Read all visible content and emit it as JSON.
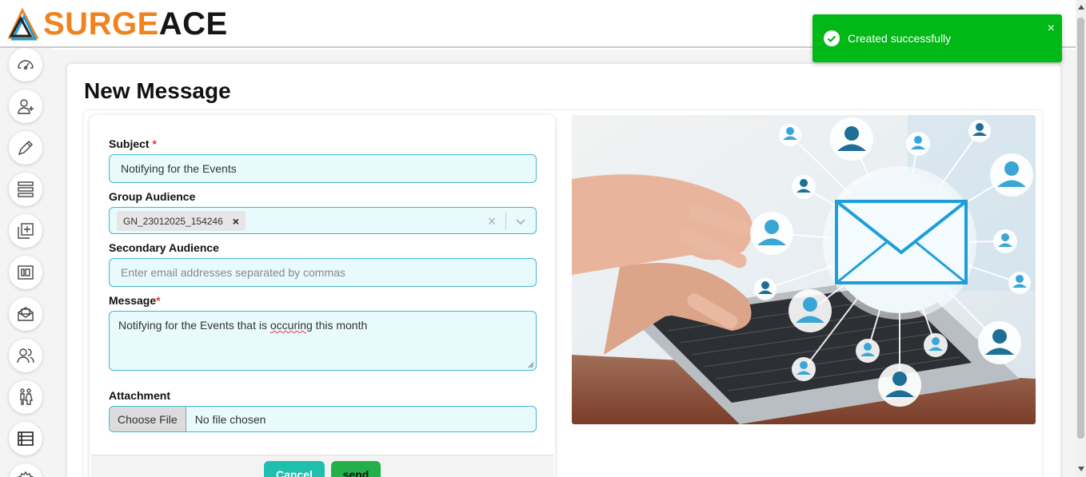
{
  "brand": {
    "logo_part1": "SURGE",
    "logo_part2": "ACE",
    "accent": "#f0831f"
  },
  "sidebar": {
    "items": [
      {
        "icon": "dashboard-icon"
      },
      {
        "icon": "add-user-icon"
      },
      {
        "icon": "pen-icon"
      },
      {
        "icon": "list-icon"
      },
      {
        "icon": "library-add-icon"
      },
      {
        "icon": "media-icon"
      },
      {
        "icon": "envelope-open-icon"
      },
      {
        "icon": "users-icon"
      },
      {
        "icon": "people-icon"
      },
      {
        "icon": "table-icon"
      },
      {
        "icon": "settings-icon"
      }
    ]
  },
  "page": {
    "title": "New Message"
  },
  "form": {
    "subject_label": "Subject",
    "subject_required": "*",
    "subject_value": "Notifying for the Events",
    "group_label": "Group Audience",
    "group_chip": "GN_23012025_154246",
    "group_chip_remove": "×",
    "group_clear": "×",
    "secondary_label": "Secondary Audience",
    "secondary_placeholder": "Enter email addresses separated by commas",
    "message_label": "Message",
    "message_required": "*",
    "message_before": "Notifying for the Events that is ",
    "message_misspelled": "occuring",
    "message_after": " this month",
    "attachment_label": "Attachment",
    "choose_file": "Choose File",
    "no_file": "No file chosen",
    "cancel_label": "Cancel",
    "send_label": "send"
  },
  "toast": {
    "text": "Created successfully",
    "close": "×",
    "color": "#00b816"
  },
  "colors": {
    "field_bg": "#e9fafd",
    "field_border": "#43b6cf",
    "cancel": "#1fbfae",
    "send": "#23b04a"
  }
}
